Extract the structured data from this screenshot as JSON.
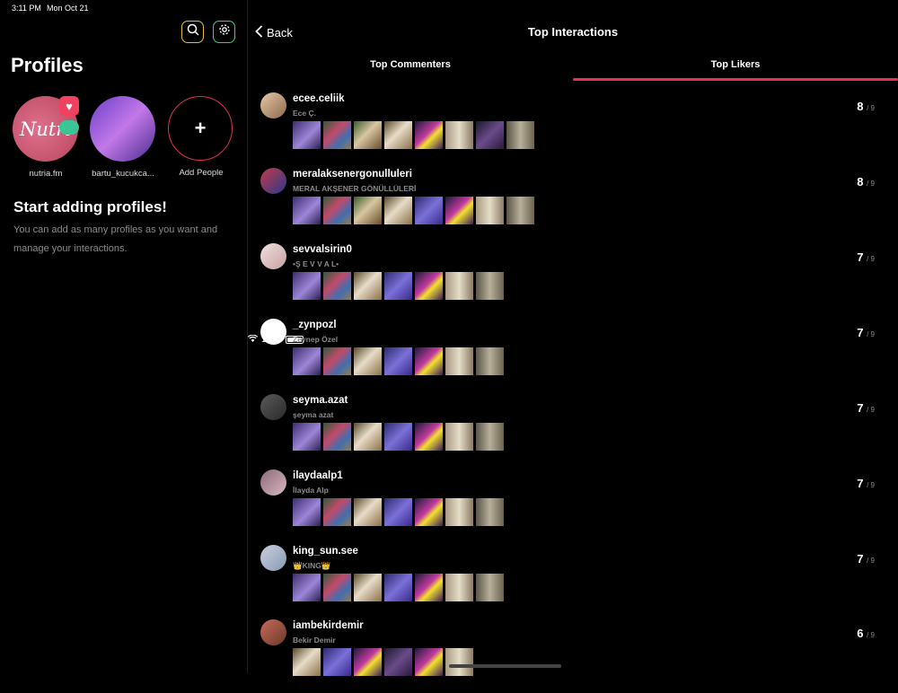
{
  "status": {
    "time": "3:11 PM",
    "date": "Mon Oct 21",
    "battery": "100%"
  },
  "left": {
    "title": "Profiles",
    "profiles": [
      {
        "label": "nutria.fm",
        "avatar_text": "Nutri"
      },
      {
        "label": "bartu_kucukca..."
      }
    ],
    "add_people": {
      "icon": "+",
      "label": "Add People"
    },
    "start_title": "Start adding profiles!",
    "start_desc": "You can add as many profiles as you want and manage your interactions."
  },
  "right": {
    "back_label": "Back",
    "title": "Top Interactions",
    "tabs": [
      {
        "label": "Top Commenters",
        "active": false
      },
      {
        "label": "Top Likers",
        "active": true
      }
    ],
    "accent_color": "#e8304f",
    "rows": [
      {
        "username": "ecee.celiik",
        "fullname": "Ece Ç.",
        "count": "8",
        "total": "/ 9",
        "thumbs": [
          "a",
          "b",
          "c",
          "d",
          "f",
          "g",
          "h",
          "i"
        ]
      },
      {
        "username": "meralaksenergonulluleri",
        "fullname": "MERAL AKŞENER GÖNÜLLÜLERİ",
        "count": "8",
        "total": "/ 9",
        "thumbs": [
          "a",
          "b",
          "c",
          "d",
          "e",
          "f",
          "g",
          "i"
        ]
      },
      {
        "username": "sevvalsirin0",
        "fullname": "•Ş E V V A L•",
        "count": "7",
        "total": "/ 9",
        "thumbs": [
          "a",
          "b",
          "d",
          "e",
          "f",
          "g",
          "i"
        ]
      },
      {
        "username": "_zynpozl",
        "fullname": "Zeynep Özel",
        "count": "7",
        "total": "/ 9",
        "thumbs": [
          "a",
          "b",
          "d",
          "e",
          "f",
          "g",
          "i"
        ]
      },
      {
        "username": "seyma.azat",
        "fullname": "şeyma azat",
        "count": "7",
        "total": "/ 9",
        "thumbs": [
          "a",
          "b",
          "d",
          "e",
          "f",
          "g",
          "i"
        ]
      },
      {
        "username": "ilaydaalp1",
        "fullname": "İlayda Alp",
        "count": "7",
        "total": "/ 9",
        "thumbs": [
          "a",
          "b",
          "d",
          "e",
          "f",
          "g",
          "i"
        ]
      },
      {
        "username": "king_sun.see",
        "fullname": "👑KING👑",
        "count": "7",
        "total": "/ 9",
        "thumbs": [
          "a",
          "b",
          "d",
          "e",
          "f",
          "g",
          "i"
        ]
      },
      {
        "username": "iambekirdemir",
        "fullname": "Bekir Demir",
        "count": "6",
        "total": "/ 9",
        "thumbs": [
          "d",
          "e",
          "f",
          "h",
          "f",
          "g"
        ]
      }
    ]
  }
}
